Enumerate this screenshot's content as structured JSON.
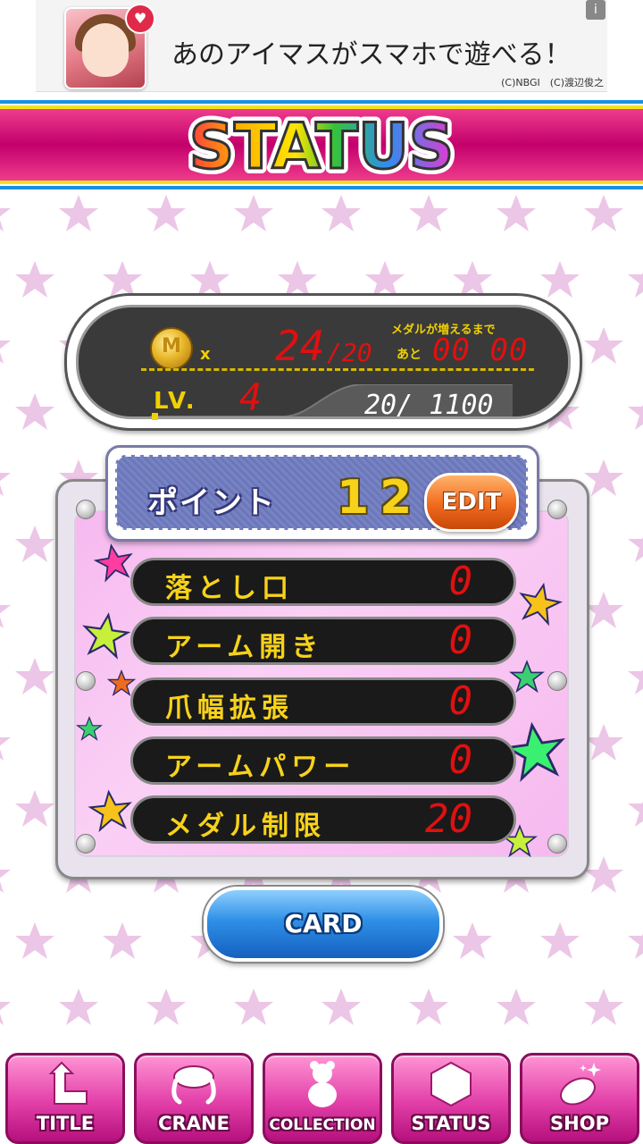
{
  "ad": {
    "text": "あのアイマスがスマホで遊べる！",
    "copyright": "(C)NBGI　(C)渡辺俊之",
    "info_icon": "info-icon",
    "heart_icon": "heart-icon"
  },
  "header": {
    "title": "STATUS"
  },
  "status": {
    "medal_count": "24",
    "medal_max": "/20",
    "medal_x": "x",
    "until_more_label": "メダルが増えるまで",
    "ato_label": "あと",
    "timer": "00 00",
    "level_label": "LV.",
    "level_value": "4",
    "exp_text": "20/ 1100",
    "exp_progress": 0.018
  },
  "points": {
    "label": "ポイント",
    "value": "12",
    "edit_label": "EDIT"
  },
  "skills": [
    {
      "name": "落とし口",
      "value": "0"
    },
    {
      "name": "アーム開き",
      "value": "0"
    },
    {
      "name": "爪幅拡張",
      "value": "0"
    },
    {
      "name": "アームパワー",
      "value": "0"
    },
    {
      "name": "メダル制限",
      "value": "20"
    }
  ],
  "card_button": "CARD",
  "nav": [
    {
      "label": "TITLE",
      "icon": "return-arrow-icon"
    },
    {
      "label": "CRANE",
      "icon": "crane-claw-icon"
    },
    {
      "label": "COLLECTION",
      "icon": "bear-figure-icon"
    },
    {
      "label": "STATUS",
      "icon": "hexagon-icon"
    },
    {
      "label": "SHOP",
      "icon": "coin-sparkle-icon"
    }
  ],
  "colors": {
    "accent_pink": "#e23fa8",
    "digit_red": "#e01010",
    "label_yellow": "#f7d21a",
    "button_blue": "#2e8fe6",
    "edit_orange": "#f06a1e"
  }
}
